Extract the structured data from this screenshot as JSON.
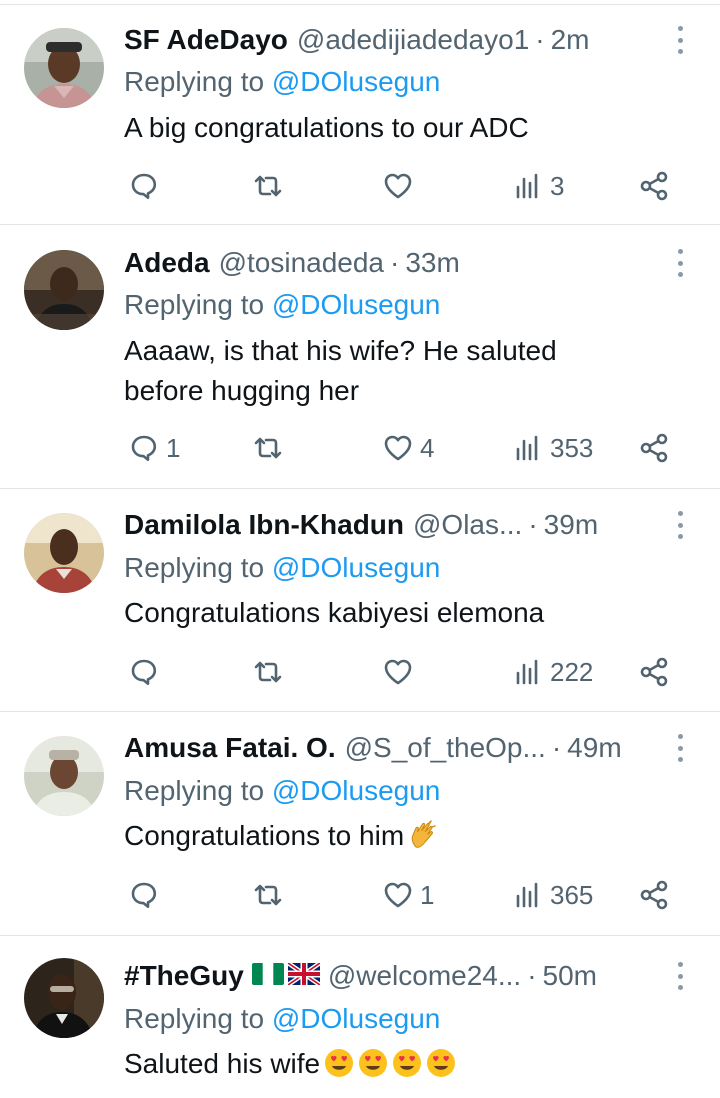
{
  "reply_prefix": "Replying to",
  "colors": {
    "text": "#0f1419",
    "secondary": "#536471",
    "link": "#1d9bf0",
    "divider": "#e1e5e8"
  },
  "icons": {
    "reply": "speech-bubble-icon",
    "retweet": "retweet-arrows-icon",
    "like": "heart-icon",
    "views": "bar-chart-icon",
    "share": "share-nodes-icon",
    "more": "vertical-ellipsis-icon"
  },
  "tweets": [
    {
      "name": "SF AdeDayo",
      "handle": "@adedijiadedayo1",
      "time": "2m",
      "mention": "@DOlusegun",
      "text": "A big congratulations to our ADC",
      "emojis": [],
      "replies": "",
      "retweets": "",
      "likes": "",
      "views": "3"
    },
    {
      "name": "Adeda",
      "handle": "@tosinadeda",
      "time": "33m",
      "mention": "@DOlusegun",
      "text": "Aaaaw, is that his wife? He saluted before hugging her",
      "emojis": [],
      "replies": "1",
      "retweets": "",
      "likes": "4",
      "views": "353"
    },
    {
      "name": "Damilola Ibn-Khadun",
      "handle": "@Olas...",
      "time": "39m",
      "mention": "@DOlusegun",
      "text": "Congratulations kabiyesi elemona",
      "emojis": [],
      "replies": "",
      "retweets": "",
      "likes": "",
      "views": "222"
    },
    {
      "name": "Amusa Fatai. O.",
      "handle": "@S_of_theOp...",
      "time": "49m",
      "mention": "@DOlusegun",
      "text": "Congratulations to him",
      "emojis": [
        "clapping-hands-emoji"
      ],
      "replies": "",
      "retweets": "",
      "likes": "1",
      "views": "365"
    },
    {
      "name": "#TheGuy",
      "name_flags": [
        "nigeria-flag-emoji",
        "uk-flag-emoji"
      ],
      "handle": "@welcome24...",
      "time": "50m",
      "mention": "@DOlusegun",
      "text": "Saluted his wife",
      "emojis": [
        "heart-eyes-emoji",
        "heart-eyes-emoji",
        "heart-eyes-emoji",
        "heart-eyes-emoji"
      ]
    }
  ]
}
